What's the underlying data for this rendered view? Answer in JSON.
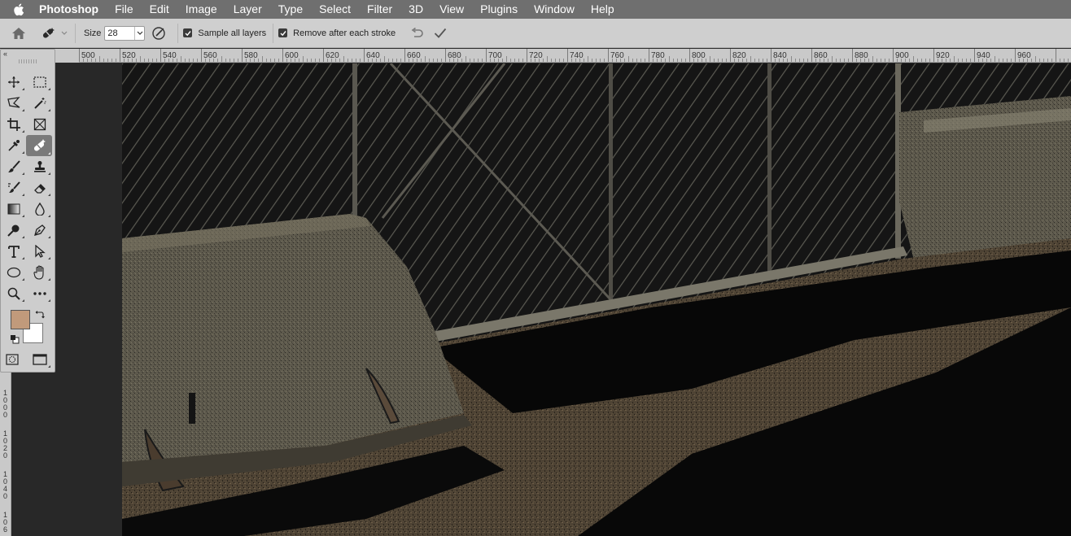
{
  "menubar": {
    "app_name": "Photoshop",
    "items": [
      "File",
      "Edit",
      "Image",
      "Layer",
      "Type",
      "Select",
      "Filter",
      "3D",
      "View",
      "Plugins",
      "Window",
      "Help"
    ]
  },
  "options_bar": {
    "size_label": "Size",
    "size_value": "28",
    "sample_all_layers_label": "Sample all layers",
    "sample_all_layers_checked": true,
    "remove_after_stroke_label": "Remove after each stroke",
    "remove_after_stroke_checked": true
  },
  "ruler": {
    "top_labels": [
      "500",
      "520",
      "540",
      "560",
      "580",
      "600",
      "620",
      "640",
      "660",
      "680",
      "700",
      "720",
      "740",
      "760",
      "780",
      "800",
      "820",
      "840",
      "860",
      "880",
      "900",
      "920",
      "940",
      "960"
    ],
    "left_labels": [
      "1 0 0 0",
      "1 0 2 0",
      "1 0 4 0",
      "1 0 6"
    ]
  },
  "toolbar": {
    "tools": [
      "move-tool-icon",
      "rectangular-marquee-icon",
      "polygonal-lasso-icon",
      "magic-wand-icon",
      "crop-tool-icon",
      "frame-tool-icon",
      "eyedropper-icon",
      "remove-tool-icon",
      "brush-tool-icon",
      "clone-stamp-icon",
      "history-brush-icon",
      "eraser-icon",
      "gradient-tool-icon",
      "blur-tool-icon",
      "dodge-tool-icon",
      "pen-tool-icon",
      "type-tool-icon",
      "path-selection-icon",
      "ellipse-tool-icon",
      "hand-tool-icon",
      "zoom-tool-icon",
      "more-tools-icon"
    ],
    "active_tool": "remove-tool-icon",
    "foreground_color": "#c19a7b",
    "background_color": "#ffffff"
  },
  "colors": {
    "menubar": "#6f6f6f",
    "options_bar": "#cfcfcf",
    "pasteboard": "#282828"
  }
}
